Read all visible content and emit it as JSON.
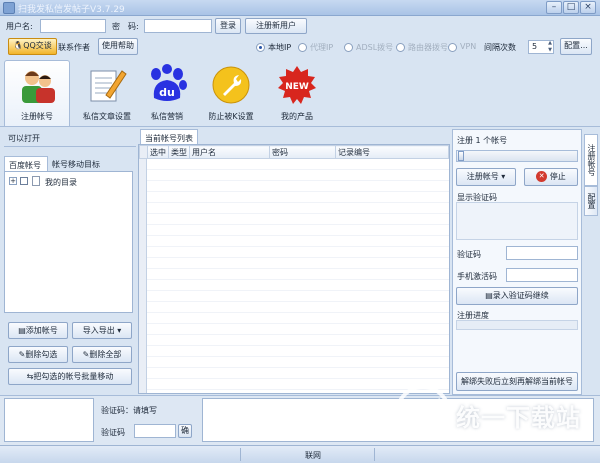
{
  "window": {
    "title": "扫我发私信发帖子V3.7.29"
  },
  "login_bar": {
    "username_label": "用户名:",
    "username_value": "",
    "password_label": "密　码:",
    "password_value": "",
    "login_button": "登录",
    "register_button": "注册新用户"
  },
  "support_bar": {
    "qq_button": "QQ交谈",
    "contact_author": "联系作者",
    "help_button": "使用帮助",
    "ip_options": [
      "本地IP",
      "代理IP",
      "ADSL拨号",
      "路由器拨号",
      "VPN"
    ],
    "ip_selected": "本地IP",
    "interval_label": "间隔次数",
    "interval_value": "5",
    "config_button": "配置..."
  },
  "toolbar": {
    "items": [
      {
        "label": "注册帐号",
        "icon": "users-icon"
      },
      {
        "label": "私信文章设置",
        "icon": "document-pencil-icon"
      },
      {
        "label": "私信营销",
        "icon": "baidu-paw-icon"
      },
      {
        "label": "防止被K设置",
        "icon": "wrench-icon"
      },
      {
        "label": "我的产品",
        "icon": "new-badge-icon"
      }
    ],
    "selected": "注册帐号"
  },
  "left_panel": {
    "header": "可以打开",
    "tabs": [
      "百度帐号",
      "帐号移动目标"
    ],
    "tree_root": "我的目录",
    "buttons": {
      "add_account": "添加帐号",
      "import_export": "导入导出",
      "delete_checked": "删除勾选",
      "delete_all": "删除全部",
      "batch_move": "把勾选的帐号批量移动"
    }
  },
  "center_panel": {
    "tab": "当前帐号列表",
    "columns": [
      "选中",
      "类型",
      "用户名",
      "密码",
      "记录编号"
    ]
  },
  "right_panel": {
    "register_count": "注册 1 个帐号",
    "register_button": "注册帐号",
    "stop_button": "停止",
    "captcha_display_label": "显示验证码",
    "captcha_label": "验证码",
    "captcha_value": "",
    "sms_label": "手机激活码",
    "sms_value": "",
    "enter_continue_button": "录入验证码继续",
    "progress_label": "注册进度",
    "progress_value": 0,
    "unbind_button": "解绑失败后立刻再解绑当前帐号",
    "side_tabs": [
      "注册帐号",
      "配置"
    ]
  },
  "bottom_panel": {
    "captcha_prompt": "验证码：请填写",
    "captcha_label": "验证码",
    "captcha_value": "",
    "confirm_button": "确"
  },
  "status_bar": {
    "text": "联网"
  },
  "watermark": {
    "text": "统一下载站",
    "sub": "www.3987.com"
  },
  "colors": {
    "accent": "#2a56a8",
    "stop_red": "#d23a2e",
    "qq_yellow": "#f2b52a"
  }
}
